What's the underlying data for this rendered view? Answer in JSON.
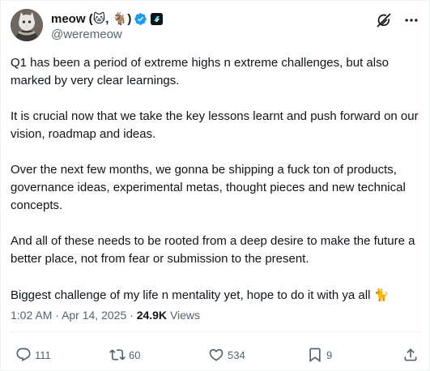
{
  "author": {
    "display_name": "meow (🐱, 🐐)",
    "handle": "@weremeow",
    "verified": true
  },
  "icons": {
    "avatar": "avatar-image",
    "verified": "verified-badge-icon",
    "affiliation": "affiliation-badge-icon",
    "grok": "grok-icon",
    "more": "more-icon",
    "reply": "reply-icon",
    "retweet": "retweet-icon",
    "like": "like-icon",
    "bookmark": "bookmark-icon",
    "share": "share-icon"
  },
  "tweet": {
    "paragraphs": [
      "Q1 has been a period of extreme highs n extreme challenges, but also marked by very clear learnings.",
      "It is crucial now that we take the key lessons learnt and push forward on our vision, roadmap and ideas.",
      "Over the next few months, we gonna be shipping a fuck ton of products, governance ideas, experimental metas, thought pieces and new technical concepts.",
      "And all of these needs to be rooted from a deep desire to make the future a better place, not from fear or submission to the present.",
      "Biggest challenge of my life n mentality yet, hope to do it with ya all"
    ],
    "trailing_emoji": "🐈"
  },
  "meta": {
    "time": "1:02 AM",
    "separator": "·",
    "date": "Apr 14, 2025",
    "views_count": "24.9K",
    "views_label": "Views"
  },
  "actions": {
    "reply_count": "111",
    "retweet_count": "60",
    "like_count": "534",
    "bookmark_count": "9"
  },
  "colors": {
    "text": "#0f1419",
    "secondary": "#536471",
    "verified_blue": "#1d9bf0",
    "divider": "#eff3f4"
  }
}
